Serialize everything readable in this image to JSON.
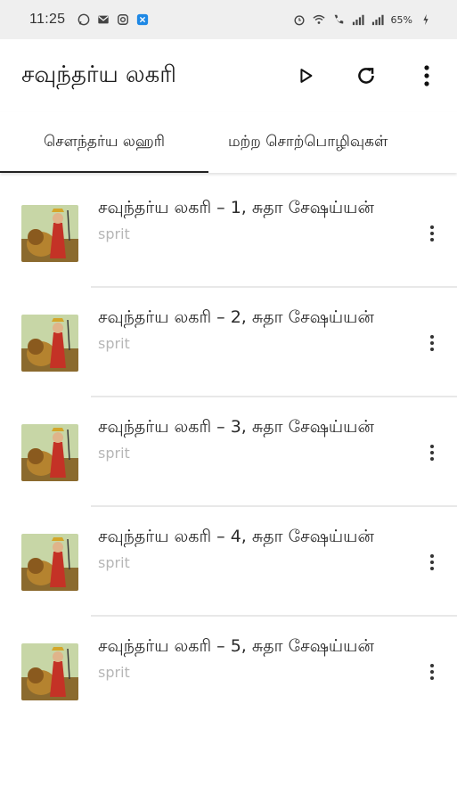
{
  "status_bar": {
    "time": "11:25",
    "battery": "65%",
    "left_icons": [
      "whatsapp-icon",
      "mail-icon",
      "instagram-icon",
      "app-icon"
    ],
    "right_icons": [
      "alarm-icon",
      "wifi-icon",
      "call-icon",
      "signal-icon",
      "signal-icon",
      "battery-icon"
    ]
  },
  "app_bar": {
    "title": "சவுந்தர்ய லகரி",
    "actions": [
      "play-icon",
      "refresh-icon",
      "more-vert-icon"
    ]
  },
  "tabs": [
    {
      "label": "சௌந்தர்ய லஹரி",
      "active": true
    },
    {
      "label": "மற்ற சொற்பொழிவுகள்",
      "active": false
    }
  ],
  "items": [
    {
      "title": "சவுந்தர்ய லகரி – 1, சுதா சேஷய்யன்",
      "subtitle": "sprit"
    },
    {
      "title": "சவுந்தர்ய லகரி – 2, சுதா சேஷய்யன்",
      "subtitle": "sprit"
    },
    {
      "title": "சவுந்தர்ய லகரி – 3, சுதா சேஷய்யன்",
      "subtitle": "sprit"
    },
    {
      "title": "சவுந்தர்ய லகரி – 4, சுதா சேஷய்யன்",
      "subtitle": "sprit"
    },
    {
      "title": "சவுந்தர்ய லகரி – 5, சுதா சேஷய்யன்",
      "subtitle": "sprit"
    }
  ]
}
